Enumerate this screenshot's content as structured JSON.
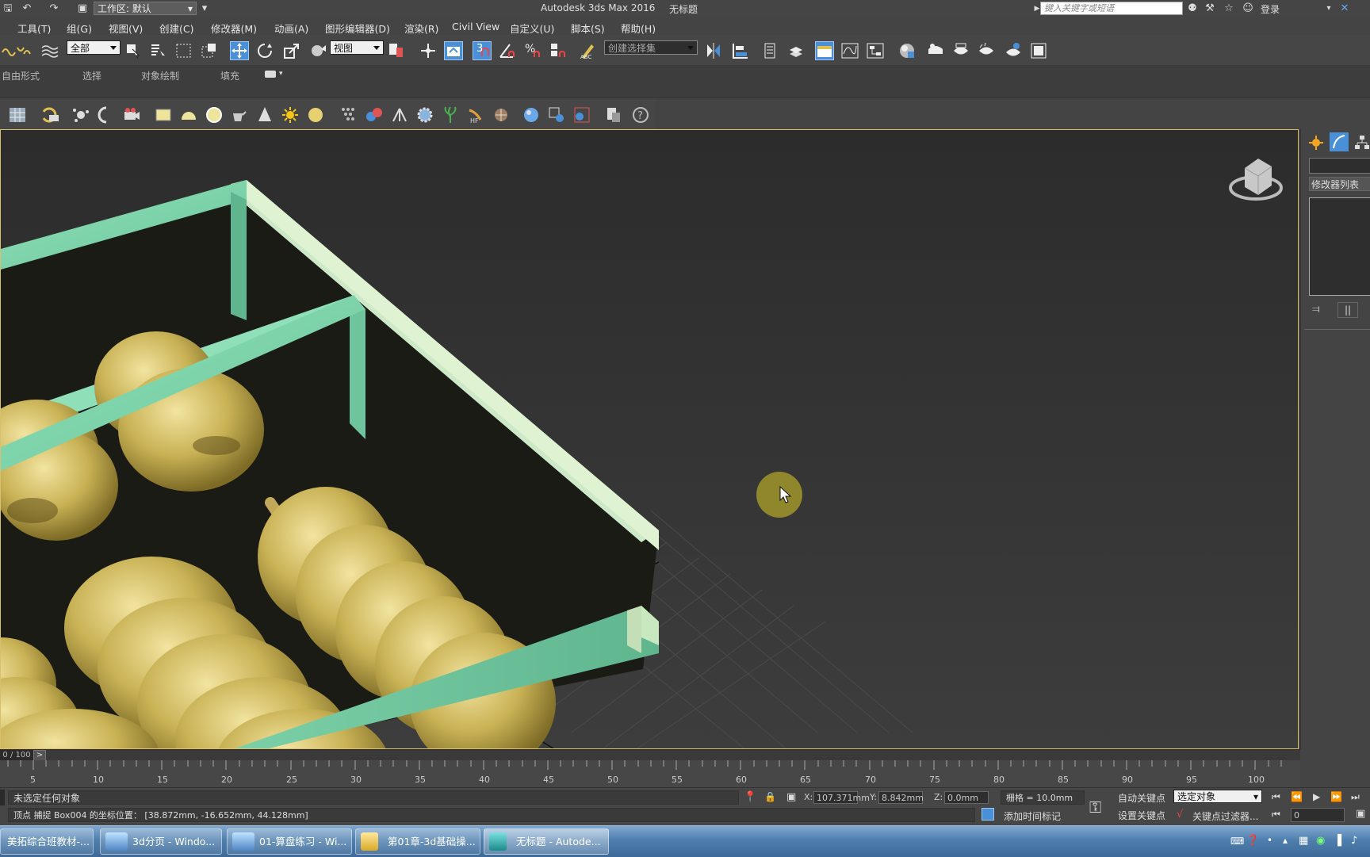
{
  "window": {
    "title": "Autodesk 3ds Max 2016",
    "doc_title": "无标题",
    "workspace_label": "工作区: 默认",
    "search_placeholder": "键入关键字或短语",
    "login_label": "登录"
  },
  "menu": [
    "工具(T)",
    "组(G)",
    "视图(V)",
    "创建(C)",
    "修改器(M)",
    "动画(A)",
    "图形编辑器(D)",
    "渲染(R)",
    "Civil View",
    "自定义(U)",
    "脚本(S)",
    "帮助(H)"
  ],
  "toolbar": {
    "selection_filter": "全部",
    "ref_coord": "视图",
    "named_selection": "创建选择集",
    "snap_value": "3"
  },
  "ribbon": {
    "tabs": [
      "自由形式",
      "选择",
      "对象绘制",
      "填充"
    ]
  },
  "command_panel": {
    "modifier_list": "修改器列表"
  },
  "timeline": {
    "position": "0 / 100",
    "arrow": ">",
    "ticks": [
      "5",
      "10",
      "15",
      "20",
      "25",
      "30",
      "35",
      "40",
      "45",
      "50",
      "55",
      "60",
      "65",
      "70",
      "75",
      "80",
      "85",
      "90",
      "95",
      "100"
    ]
  },
  "status": {
    "selection_text": "未选定任何对象",
    "prompt_text": "顶点 捕捉 Box004 的坐标位置：  [38.872mm, -16.652mm, 44.128mm]",
    "x_label": "X:",
    "x_value": "107.371mm",
    "y_label": "Y:",
    "y_value": "8.842mm",
    "z_label": "Z:",
    "z_value": "0.0mm",
    "grid_text": "栅格 = 10.0mm",
    "auto_key": "自动关键点",
    "set_key": "设置关键点",
    "key_filter_dropdown": "选定对象",
    "key_filters": "关键点过滤器...",
    "add_time_tag": "添加时间标记",
    "frame_value": "0"
  },
  "taskbar": {
    "items": [
      {
        "label": "美拓综合班教材-...",
        "active": false
      },
      {
        "label": "3d分页 - Windo...",
        "active": false
      },
      {
        "label": "01-算盘练习 - Wi...",
        "active": false
      },
      {
        "label": "第01章-3d基础操...",
        "active": false
      },
      {
        "label": "无标题 - Autode...",
        "active": true
      }
    ]
  },
  "colors": {
    "frame": "#7fd4a8",
    "bead": "#c9b255",
    "viewport_border": "#d8c070",
    "cursor_highlight": "#9a8f2a"
  }
}
